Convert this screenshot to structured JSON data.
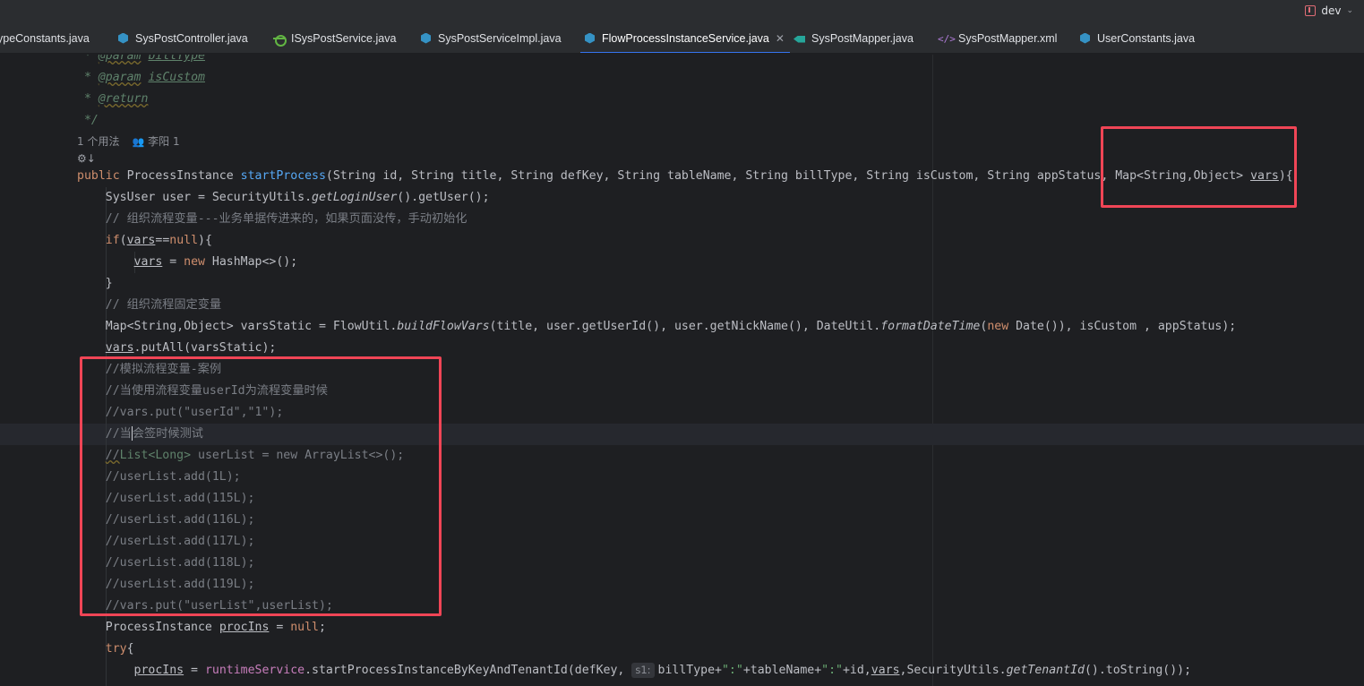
{
  "branch": {
    "name": "dev"
  },
  "tabs": [
    {
      "label": "ypeConstants.java",
      "icon": "none",
      "left": 0
    },
    {
      "label": "SysPostController.java",
      "icon": "java"
    },
    {
      "label": "ISysPostService.java",
      "icon": "iface"
    },
    {
      "label": "SysPostServiceImpl.java",
      "icon": "java"
    },
    {
      "label": "FlowProcessInstanceService.java",
      "icon": "java",
      "active": true
    },
    {
      "label": "SysPostMapper.java",
      "icon": "mapper"
    },
    {
      "label": "SysPostMapper.xml",
      "icon": "xml"
    },
    {
      "label": "UserConstants.java",
      "icon": "java"
    }
  ],
  "editor": {
    "usages": "1 个用法",
    "author": "李阳 1",
    "inlay_hint": "s1:",
    "code": {
      "l_param_billtype": [
        "* ",
        "@param",
        " ",
        "billType"
      ],
      "l_param_iscustom": [
        "* ",
        "@param",
        " ",
        "isCustom"
      ],
      "l_return": [
        "* ",
        "@return"
      ],
      "l_end": "*/",
      "sig": [
        "public",
        " ProcessInstance ",
        "startProcess",
        "(String id, String title, String defKey, String tableName, String billType, String isCustom, String appStatus, Map<String,Object> ",
        "vars",
        "){"
      ],
      "user": [
        "SysUser user = SecurityUtils.",
        "getLoginUser",
        "().getUser();"
      ],
      "c1": "// 组织流程变量---业务单据传进来的，如果页面没传，手动初始化",
      "if": [
        "if",
        "(",
        "vars",
        "==",
        "null",
        "){"
      ],
      "newmap": [
        "vars",
        " = ",
        "new",
        " HashMap<>();"
      ],
      "close1": "}",
      "c2": "// 组织流程固定变量",
      "vs": [
        "Map<String,Object> varsStatic = FlowUtil.",
        "buildFlowVars",
        "(title, user.getUserId(), user.getNickName(), DateUtil.",
        "formatDateTime",
        "(",
        "new",
        " Date()), isCustom , appStatus);"
      ],
      "putall": [
        "vars",
        ".putAll(varsStatic);"
      ],
      "m1": "//模拟流程变量-案例",
      "m2": "//当使用流程变量userId为流程变量时候",
      "m3": "//vars.put(\"userId\",\"1\");",
      "m4a": "//当",
      "m4b": "会签时候测试",
      "m5": [
        "//",
        "List<Long>",
        " userList = new ArrayList<>();"
      ],
      "m6": "//userList.add(1L);",
      "m7": "//userList.add(115L);",
      "m8": "//userList.add(116L);",
      "m9": "//userList.add(117L);",
      "m10": "//userList.add(118L);",
      "m11": "//userList.add(119L);",
      "m12": "//vars.put(\"userList\",userList);",
      "procins": [
        "ProcessInstance ",
        "procIns",
        " = ",
        "null",
        ";"
      ],
      "try": [
        "try",
        "{"
      ],
      "start": [
        "procIns",
        " = ",
        "runtimeService",
        ".startProcessInstanceByKeyAndTenantId(defKey, ",
        "billType+",
        "\":\"",
        "+tableName+",
        "\":\"",
        "+id,",
        "vars",
        ",SecurityUtils.",
        "getTenantId",
        "().toString());"
      ]
    }
  },
  "colors": {
    "annotation": "#f04556",
    "accent": "#3574f0"
  }
}
